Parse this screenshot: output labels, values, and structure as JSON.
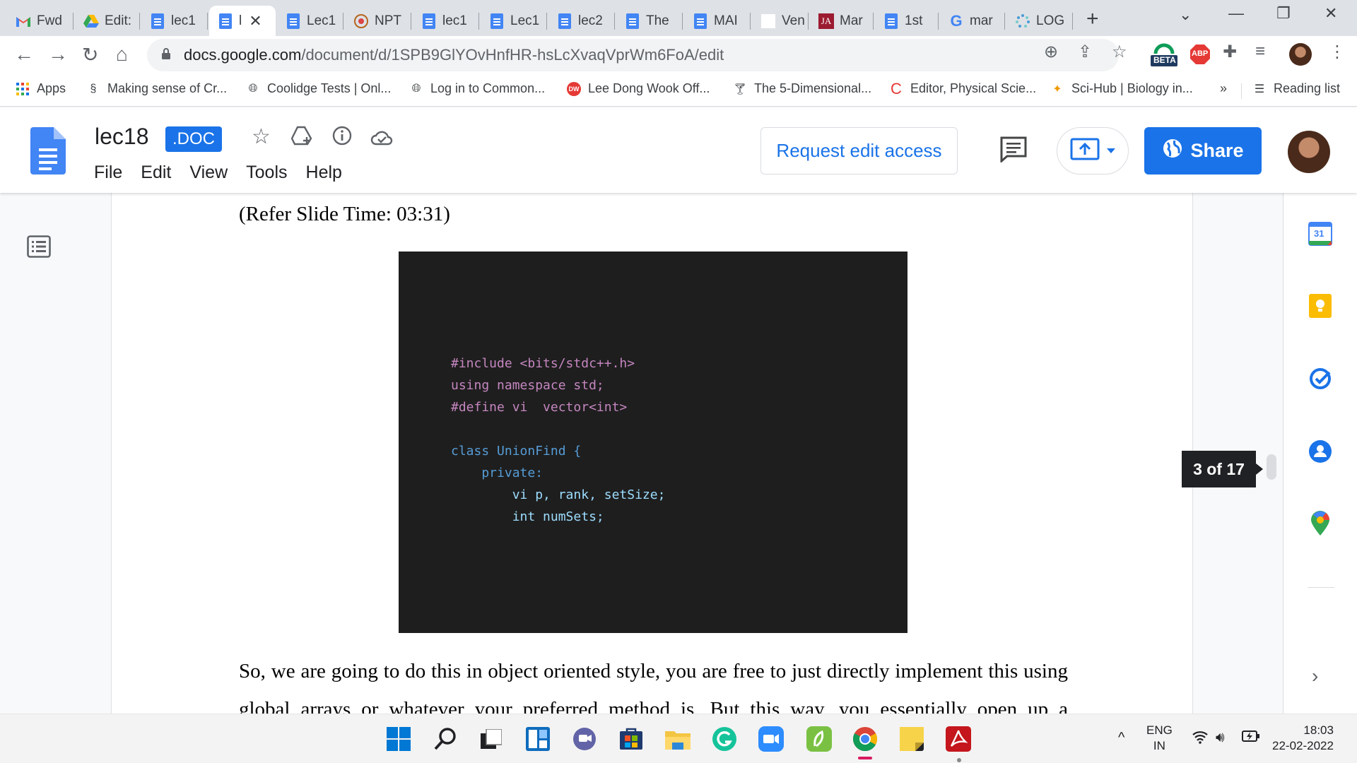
{
  "browser": {
    "tabs": [
      {
        "label": "Fwd",
        "favicon": "gmail-icon"
      },
      {
        "label": "Edit:",
        "favicon": "drive-icon"
      },
      {
        "label": "lec1",
        "favicon": "docs-icon"
      },
      {
        "label": "l",
        "favicon": "docs-icon",
        "active": true
      },
      {
        "label": "Lec1",
        "favicon": "docs-icon"
      },
      {
        "label": "NPT",
        "favicon": "nptel-icon"
      },
      {
        "label": "lec1",
        "favicon": "docs-icon"
      },
      {
        "label": "Lec1",
        "favicon": "docs-icon"
      },
      {
        "label": "lec2",
        "favicon": "docs-icon"
      },
      {
        "label": "The",
        "favicon": "docs-icon"
      },
      {
        "label": "MAI",
        "favicon": "docs-icon"
      },
      {
        "label": "Ven",
        "favicon": "blank-icon"
      },
      {
        "label": "Mar",
        "favicon": "ja-icon"
      },
      {
        "label": "1st",
        "favicon": "docs-icon"
      },
      {
        "label": "mar",
        "favicon": "google-icon"
      },
      {
        "label": "LOG",
        "favicon": "loading-icon"
      }
    ],
    "url_host": "docs.google.com",
    "url_path": "/document/d/1SPB9GlYOvHnfHR-hsLcXvaqVprWm6FoA/edit",
    "extension_badges": {
      "beta": "BETA",
      "abp": "ABP"
    },
    "bookmarks": [
      {
        "label": "Apps",
        "icon": "apps-grid-icon"
      },
      {
        "label": "Making sense of Cr...",
        "icon": "bookmark-site-icon"
      },
      {
        "label": "Coolidge Tests | Onl...",
        "icon": "globe-icon"
      },
      {
        "label": "Log in to Common...",
        "icon": "globe-icon"
      },
      {
        "label": "Lee Dong Wook Off...",
        "icon": "dw-icon"
      },
      {
        "label": "The 5-Dimensional...",
        "icon": "cocktail-icon"
      },
      {
        "label": "Editor, Physical Scie...",
        "icon": "c-logo-icon"
      },
      {
        "label": "Sci-Hub | Biology in...",
        "icon": "scihub-icon"
      }
    ],
    "bookmarks_overflow": "»",
    "reading_list": "Reading list"
  },
  "docs": {
    "title": "lec18",
    "badge": ".DOC",
    "menu": [
      "File",
      "Edit",
      "View",
      "Tools",
      "Help"
    ],
    "request_edit": "Request edit access",
    "share": "Share"
  },
  "document": {
    "slide_time": "(Refer Slide Time: 03:31)",
    "code_lines": [
      "#include <bits/stdc++.h>",
      "using namespace std;",
      "#define vi  vector<int>",
      "",
      "class UnionFind {",
      "    private:",
      "        vi p, rank, setSize;",
      "        int numSets;"
    ],
    "paragraph": "So, we are going to do this in object oriented style, you are free to just directly implement this using global arrays or whatever your preferred method is. But this way, you essentially open up a",
    "page_indicator": "3 of 17",
    "calendar_day": "31"
  },
  "taskbar": {
    "apps": [
      "windows-start-icon",
      "search-icon",
      "task-view-icon",
      "widgets-icon",
      "teams-chat-icon",
      "store-icon",
      "file-explorer-icon",
      "grammarly-icon",
      "zoom-icon",
      "evernote-icon",
      "chrome-icon",
      "sticky-notes-icon",
      "acrobat-icon"
    ],
    "language_line1": "ENG",
    "language_line2": "IN",
    "time": "18:03",
    "date": "22-02-2022"
  },
  "colors": {
    "accent": "#1a73e8",
    "code_bg": "#1e1e1e",
    "tab_strip": "#dee1e6"
  }
}
